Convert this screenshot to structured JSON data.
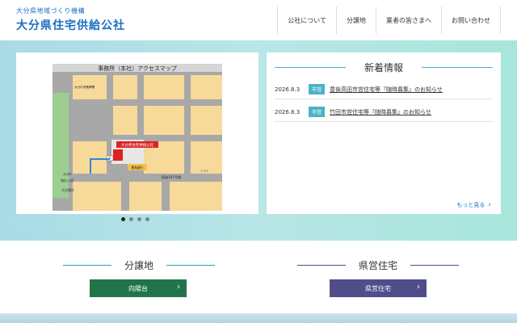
{
  "header": {
    "subtitle": "大分県地域づくり機構",
    "title": "大分県住宅供給公社",
    "nav": [
      "公社について",
      "分譲地",
      "業者の皆さまへ",
      "お問い合わせ"
    ]
  },
  "map": {
    "title": "事務所（本社）アクセスマップ",
    "office_label": "大分県住宅供給公社",
    "labels": {
      "park": "城址公園",
      "road": "国道197号線",
      "bank": "豊和銀行",
      "pref_office": "大分県庁",
      "north": "大分中央警察署",
      "store": "ソフト",
      "shop": "大分市",
      "p": "P"
    }
  },
  "carousel": {
    "count": 4,
    "active_index": 0
  },
  "news": {
    "title": "新着情報",
    "items": [
      {
        "date": "2026.8.3",
        "tag": "市営",
        "text": "豊後高田市営住宅等『随時募集』のお知らせ"
      },
      {
        "date": "2026.8.3",
        "tag": "市営",
        "text": "竹田市営住宅等『随時募集』のお知らせ"
      }
    ],
    "more": "もっと見る"
  },
  "sections": {
    "left": {
      "title": "分譲地",
      "button": "向陽台"
    },
    "right": {
      "title": "県営住宅",
      "button": "県営住宅"
    }
  },
  "colors": {
    "brand": "#1a6fc0",
    "accent": "#4bb3c7",
    "green": "#21744a",
    "purple": "#504d8a"
  }
}
